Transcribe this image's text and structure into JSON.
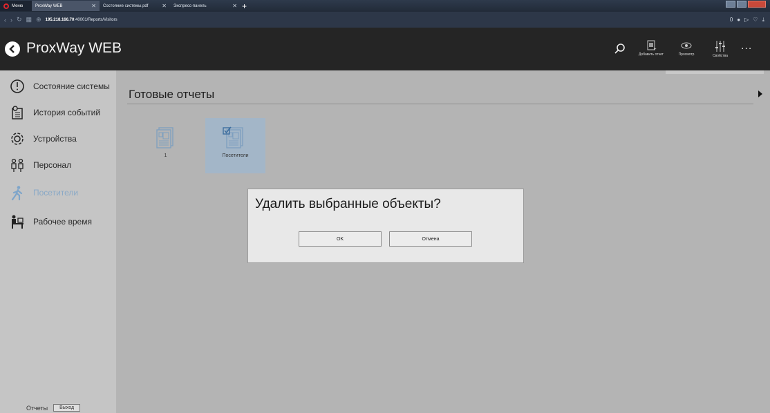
{
  "browser": {
    "menu_label": "Меню",
    "tabs": [
      {
        "label": "ProxWay WEB",
        "icon": "app-tab-icon"
      },
      {
        "label": "Состояние системы.pdf",
        "icon": "pdf-icon"
      },
      {
        "label": "Экспресс-панель",
        "icon": "grid-icon"
      }
    ],
    "url_host": "195.218.166.70",
    "url_path": ":40001/Reports/Visitors",
    "badge_count": "0"
  },
  "app": {
    "title": "ProxWay WEB",
    "header_buttons": [
      {
        "label": "",
        "icon": "search-icon"
      },
      {
        "label": "Добавить отчет",
        "icon": "add-report-icon"
      },
      {
        "label": "Просмотр",
        "icon": "eye-icon"
      },
      {
        "label": "Свойства",
        "icon": "sliders-icon"
      },
      {
        "label": "...",
        "icon": "more-icon"
      }
    ]
  },
  "sidebar": {
    "items": [
      {
        "label": "Состояние системы",
        "icon": "system-status-icon"
      },
      {
        "label": "История событий",
        "icon": "event-history-icon"
      },
      {
        "label": "Устройства",
        "icon": "gear-icon"
      },
      {
        "label": "Персонал",
        "icon": "personnel-icon"
      },
      {
        "label": "Посетители",
        "icon": "visitor-icon"
      },
      {
        "label": "Рабочее время",
        "icon": "worktime-icon"
      }
    ],
    "active_item": "Посетители",
    "bottom_label": "Отчеты",
    "exit_label": "Выход"
  },
  "main": {
    "section_title": "Готовые отчеты",
    "reports": [
      {
        "label": "1",
        "selected": false
      },
      {
        "label": "Посетители",
        "selected": true
      }
    ]
  },
  "dialog": {
    "message": "Удалить выбранные объекты?",
    "ok_label": "OK",
    "cancel_label": "Отмена"
  },
  "colors": {
    "app_header": "#252525",
    "sidebar": "#c5c5c5",
    "main": "#b4b4b4",
    "selection": "#a3b6c8",
    "accent": "#8aa9c6",
    "checkmark": "#3f6f9f"
  }
}
